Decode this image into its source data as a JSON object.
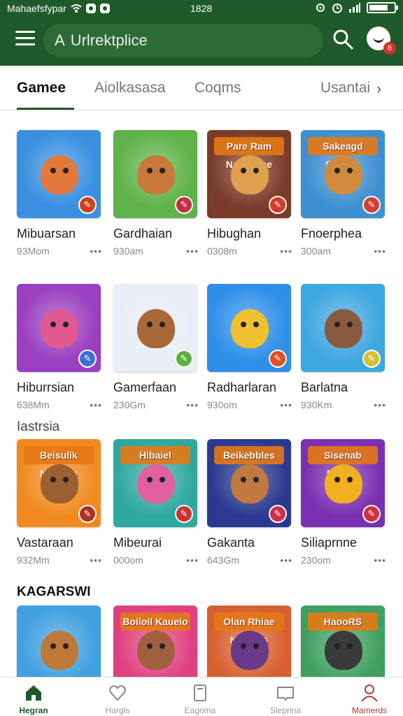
{
  "status_bar": {
    "carrier": "Mahaefsfypar",
    "time": "1828"
  },
  "header": {
    "search_prefix": "A",
    "search_value": "Urlrektplice",
    "notification_count": "6",
    "brand_color": "#1f5a2a"
  },
  "tabs": [
    {
      "label": "Gamee",
      "active": true
    },
    {
      "label": "Aiolkasasa",
      "active": false
    },
    {
      "label": "Coqms",
      "active": false
    },
    {
      "label": "Usantai",
      "active": false
    }
  ],
  "section_headings": {
    "second": "Iastrsia",
    "third": "KAGARSWI"
  },
  "games": [
    {
      "title": "Mibuarsan",
      "meta": "93Mom",
      "banner": "",
      "bg": "#3a8fe0",
      "char": "#e3783a",
      "corner": "#d04020"
    },
    {
      "title": "Gardhaian",
      "meta": "930am",
      "banner": "",
      "bg": "#5fb24a",
      "char": "#c87838",
      "corner": "#c03040"
    },
    {
      "title": "Hibughan",
      "meta": "0308m",
      "banner": "Pare Ram Nalleotiae",
      "bg": "#7a3c2a",
      "char": "#e0a050",
      "corner": "#d83a2a"
    },
    {
      "title": "Fnoerphea",
      "meta": "300am",
      "banner": "Sakeagd Shialck",
      "bg": "#3f8fd0",
      "char": "#d08a40",
      "corner": "#d04030"
    },
    {
      "title": "Hiburrsian",
      "meta": "638Mm",
      "banner": "",
      "bg": "#9a3fc0",
      "char": "#e05a90",
      "corner": "#3a70d0"
    },
    {
      "title": "Gamerfaan",
      "meta": "230Gm",
      "banner": "",
      "bg": "#e8eef5",
      "char": "#a8683a",
      "corner": "#60b040"
    },
    {
      "title": "Radharlaran",
      "meta": "930om",
      "banner": "",
      "bg": "#2f8fe8",
      "char": "#f0c030",
      "corner": "#e05020"
    },
    {
      "title": "Barlatna",
      "meta": "930Km",
      "banner": "",
      "bg": "#3fa7e0",
      "char": "#8a5a40",
      "corner": "#d8c030"
    },
    {
      "title": "Vastaraan",
      "meta": "932Mm",
      "banner": "Beisulik Nalasos",
      "bg": "#f08a20",
      "char": "#9a6030",
      "corner": "#b03020"
    },
    {
      "title": "Mibeurai",
      "meta": "000om",
      "banner": "Hibaiel",
      "bg": "#2fa8a0",
      "char": "#e060a0",
      "corner": "#d03030"
    },
    {
      "title": "Gakanta",
      "meta": "643Gm",
      "banner": "Beikebbles",
      "bg": "#2a3a90",
      "char": "#c07a40",
      "corner": "#d03050"
    },
    {
      "title": "Siliaprnne",
      "meta": "230om",
      "banner": "Sisenab Nalsps",
      "bg": "#7a30b0",
      "char": "#f0b020",
      "corner": "#d03040"
    },
    {
      "title": "",
      "meta": "",
      "banner": "",
      "bg": "#40a0e0",
      "char": "#c07838",
      "corner": ""
    },
    {
      "title": "",
      "meta": "",
      "banner": "Boiloil Kaueio",
      "bg": "#e04080",
      "char": "#a06040",
      "corner": ""
    },
    {
      "title": "",
      "meta": "",
      "banner": "Olan Rhiae Nalsbus",
      "bg": "#d86030",
      "char": "#6a3a8a",
      "corner": ""
    },
    {
      "title": "",
      "meta": "",
      "banner": "HaooRS",
      "bg": "#40a060",
      "char": "#3a3a3a",
      "corner": ""
    }
  ],
  "more_glyph": "•••",
  "bottom_nav": [
    {
      "label": "Hegran",
      "icon": "home-icon"
    },
    {
      "label": "Hargls",
      "icon": "heart-icon"
    },
    {
      "label": "Eagoma",
      "icon": "device-icon"
    },
    {
      "label": "Sleprina",
      "icon": "book-icon"
    },
    {
      "label": "Mamerds",
      "icon": "profile-icon"
    }
  ]
}
